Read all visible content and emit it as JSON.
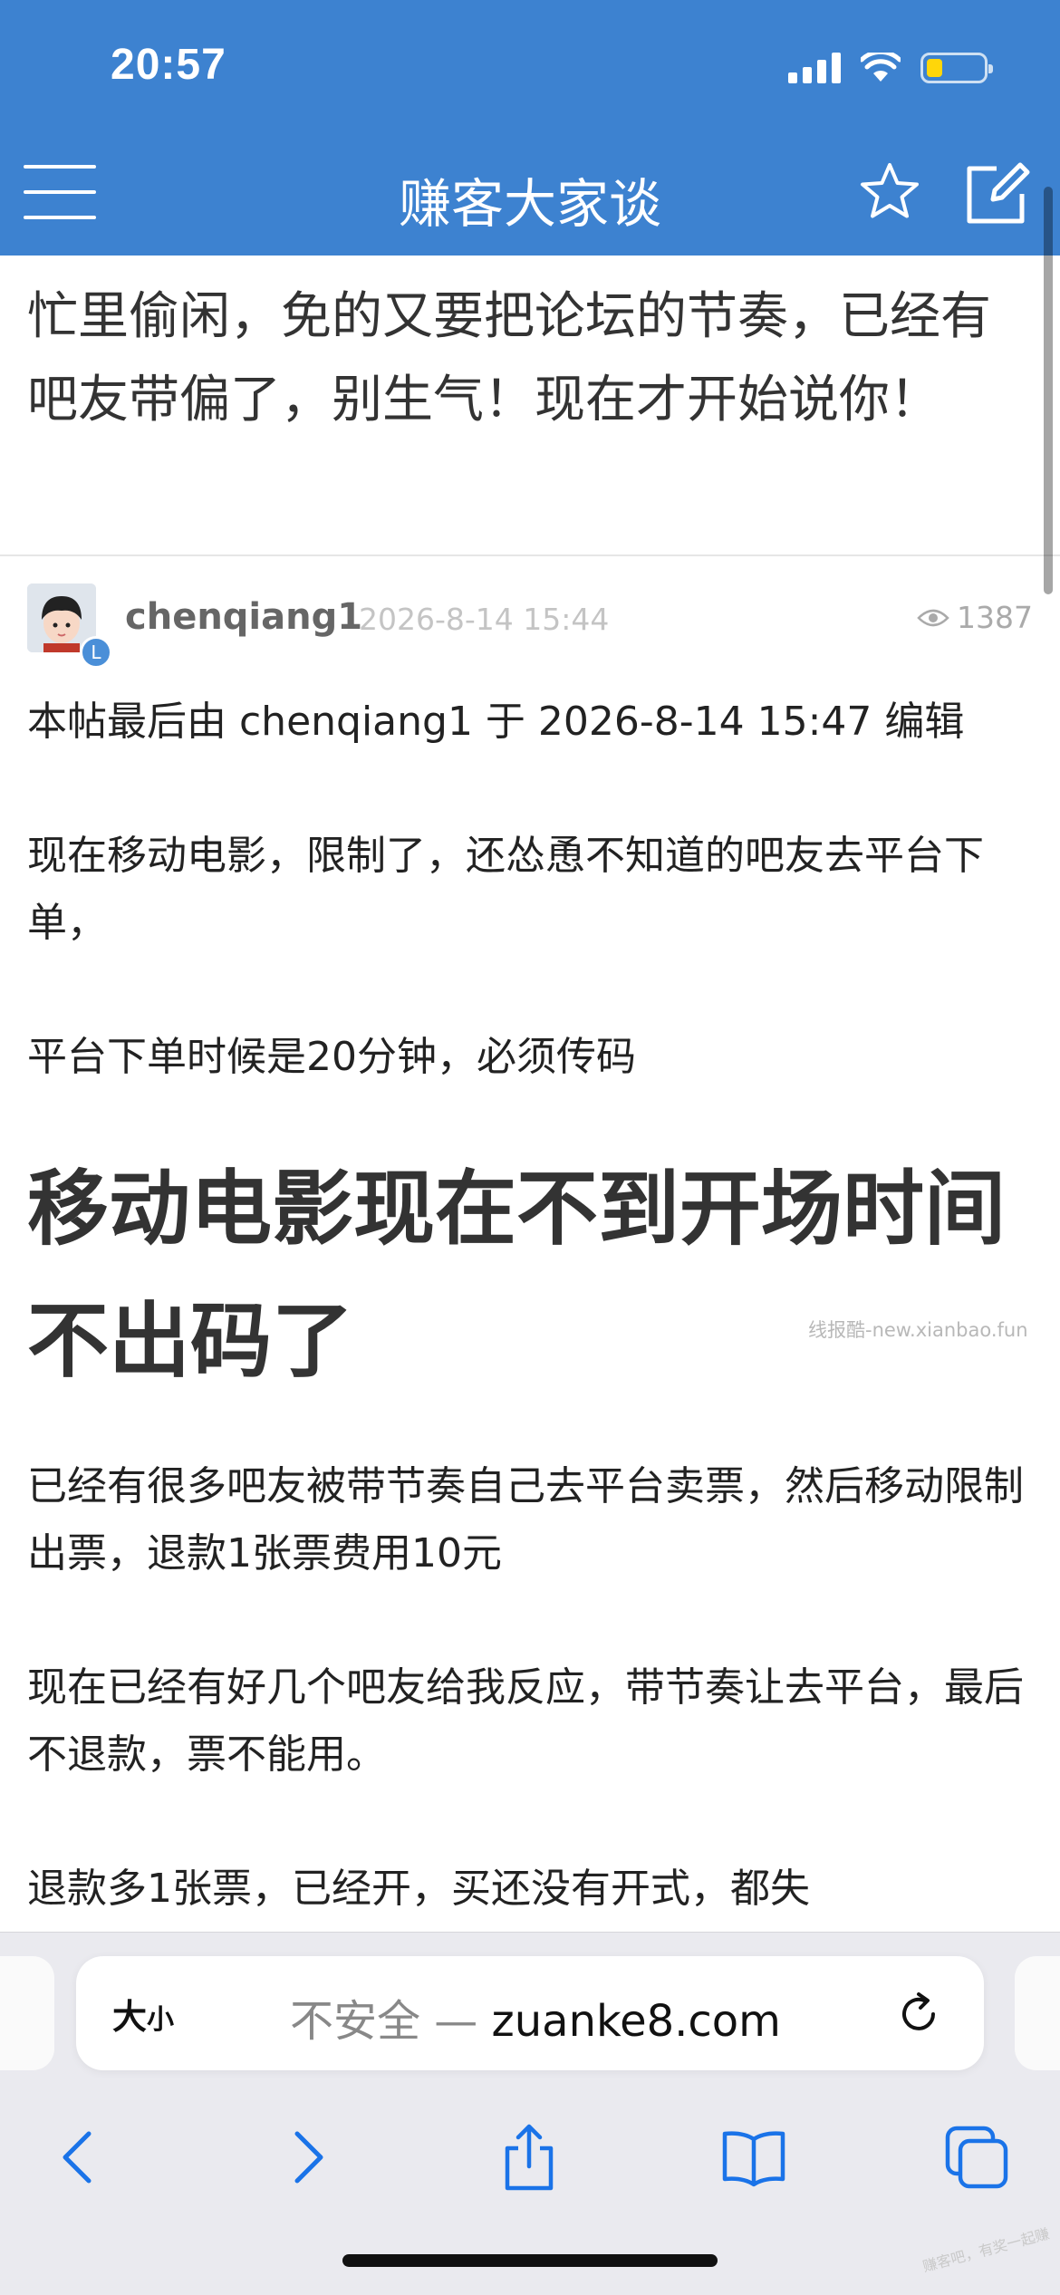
{
  "status_bar": {
    "time": "20:57"
  },
  "nav": {
    "title": "赚客大家谈"
  },
  "previous_post": {
    "text": "忙里偷闲，免的又要把论坛的节奏，已经有吧友带偏了，别生气！现在才开始说你！"
  },
  "post": {
    "username": "chenqiang1",
    "time": "2026-8-14 15:44",
    "views": "1387",
    "level_badge": "L",
    "edit_note": "本帖最后由 chenqiang1 于 2026-8-14 15:47 编辑",
    "paragraphs": [
      "现在移动电影，限制了，还怂恿不知道的吧友去平台下单，",
      "平台下单时候是20分钟，必须传码"
    ],
    "headline": "移动电影现在不到开场时间不出码了",
    "paragraphs2": [
      "已经有很多吧友被带节奏自己去平台卖票，然后移动限制出票，退款1张票费用10元",
      "现在已经有好几个吧友给我反应，带节奏让去平台，最后不退款，票不能用。"
    ],
    "cut_line": "退款多1张票，已经开，买还没有开式，都失"
  },
  "watermark": "线报酷-new.xianbao.fun",
  "safari": {
    "text_size_button": {
      "big": "大",
      "small": "小"
    },
    "insecure_label": "不安全 — ",
    "domain": "zuanke8.com"
  },
  "corner_mark": "赚客吧，有奖一起赚"
}
